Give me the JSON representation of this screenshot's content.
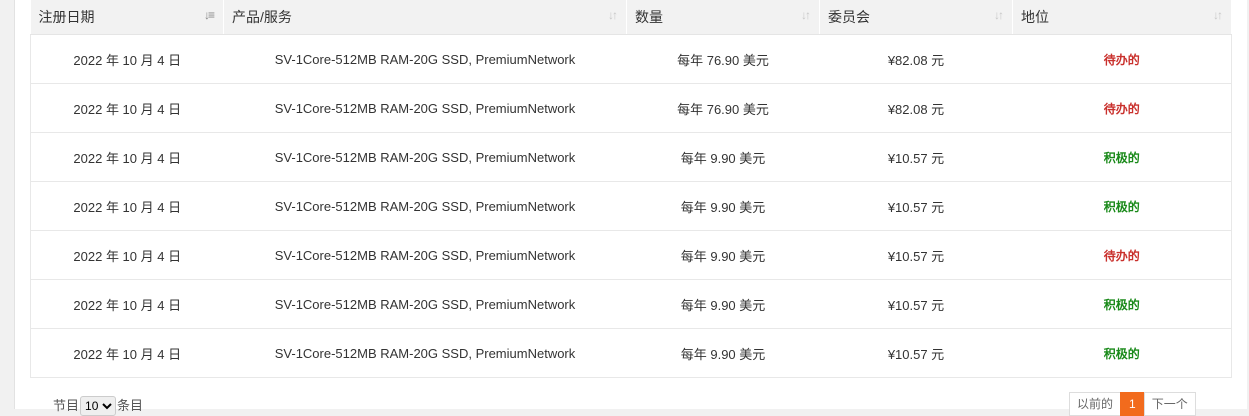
{
  "columns": [
    {
      "label": "注册日期",
      "sort_icon": "sort-desc-icon"
    },
    {
      "label": "产品/服务",
      "sort_icon": "sort-icon"
    },
    {
      "label": "数量",
      "sort_icon": "sort-icon"
    },
    {
      "label": "委员会",
      "sort_icon": "sort-icon"
    },
    {
      "label": "地位",
      "sort_icon": "sort-icon"
    }
  ],
  "rows": [
    {
      "date": "2022 年 10 月 4 日",
      "product": "SV-1Core-512MB RAM-20G SSD, PremiumNetwork",
      "amount": "每年 76.90 美元",
      "commission": "¥82.08 元",
      "status": "待办的",
      "status_type": "pending"
    },
    {
      "date": "2022 年 10 月 4 日",
      "product": "SV-1Core-512MB RAM-20G SSD, PremiumNetwork",
      "amount": "每年 76.90 美元",
      "commission": "¥82.08 元",
      "status": "待办的",
      "status_type": "pending"
    },
    {
      "date": "2022 年 10 月 4 日",
      "product": "SV-1Core-512MB RAM-20G SSD, PremiumNetwork",
      "amount": "每年 9.90 美元",
      "commission": "¥10.57 元",
      "status": "积极的",
      "status_type": "active"
    },
    {
      "date": "2022 年 10 月 4 日",
      "product": "SV-1Core-512MB RAM-20G SSD, PremiumNetwork",
      "amount": "每年 9.90 美元",
      "commission": "¥10.57 元",
      "status": "积极的",
      "status_type": "active"
    },
    {
      "date": "2022 年 10 月 4 日",
      "product": "SV-1Core-512MB RAM-20G SSD, PremiumNetwork",
      "amount": "每年 9.90 美元",
      "commission": "¥10.57 元",
      "status": "待办的",
      "status_type": "pending"
    },
    {
      "date": "2022 年 10 月 4 日",
      "product": "SV-1Core-512MB RAM-20G SSD, PremiumNetwork",
      "amount": "每年 9.90 美元",
      "commission": "¥10.57 元",
      "status": "积极的",
      "status_type": "active"
    },
    {
      "date": "2022 年 10 月 4 日",
      "product": "SV-1Core-512MB RAM-20G SSD, PremiumNetwork",
      "amount": "每年 9.90 美元",
      "commission": "¥10.57 元",
      "status": "积极的",
      "status_type": "active"
    }
  ],
  "colors": {
    "pending": "#c9302c",
    "active": "#1a8a1a",
    "pager_current": "#f26b1d"
  },
  "footer": {
    "show_prefix": "节目",
    "page_size": "10",
    "show_suffix": "条目",
    "prev_label": "以前的",
    "current_page": "1",
    "next_label": "下一个"
  }
}
